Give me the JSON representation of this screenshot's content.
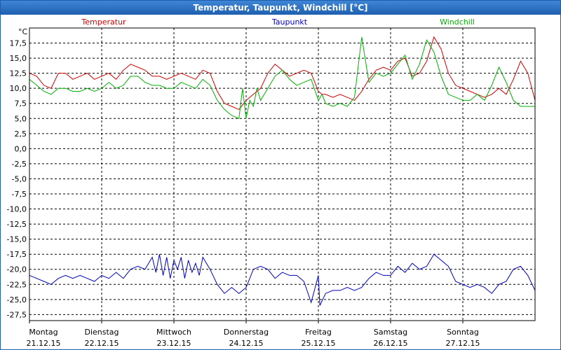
{
  "window": {
    "title": "Temperatur, Taupunkt, Windchill [°C]"
  },
  "chart_data": {
    "type": "line",
    "title": "Temperatur, Taupunkt, Windchill [°C]",
    "ylabel": "°C",
    "ylim": [
      -28.5,
      20.0
    ],
    "xlim": [
      0,
      7
    ],
    "grid": true,
    "legend": "top",
    "yticks": [
      "17,5",
      "15,0",
      "12,5",
      "10,0",
      "7,5",
      "5,0",
      "2,5",
      "0,0",
      "-2,5",
      "-5,0",
      "-7,5",
      "-10,0",
      "-12,5",
      "-15,0",
      "-17,5",
      "-20,0",
      "-22,5",
      "-25,0",
      "-27,5"
    ],
    "ytick_values": [
      17.5,
      15,
      12.5,
      10,
      7.5,
      5,
      2.5,
      0,
      -2.5,
      -5,
      -7.5,
      -10,
      -12.5,
      -15,
      -17.5,
      -20,
      -22.5,
      -25,
      -27.5
    ],
    "days": [
      {
        "name": "Montag",
        "date": "21.12.15"
      },
      {
        "name": "Dienstag",
        "date": "22.12.15"
      },
      {
        "name": "Mittwoch",
        "date": "23.12.15"
      },
      {
        "name": "Donnerstag",
        "date": "24.12.15"
      },
      {
        "name": "Freitag",
        "date": "25.12.15"
      },
      {
        "name": "Samstag",
        "date": "26.12.15"
      },
      {
        "name": "Sonntag",
        "date": "27.12.15"
      }
    ],
    "series": [
      {
        "name": "Temperatur",
        "color": "#d00000",
        "x": [
          0.0,
          0.1,
          0.2,
          0.3,
          0.4,
          0.5,
          0.6,
          0.7,
          0.8,
          0.9,
          1.0,
          1.1,
          1.2,
          1.3,
          1.4,
          1.5,
          1.6,
          1.7,
          1.8,
          1.9,
          2.0,
          2.1,
          2.2,
          2.3,
          2.4,
          2.5,
          2.6,
          2.7,
          2.8,
          2.9,
          3.0,
          3.1,
          3.2,
          3.3,
          3.4,
          3.5,
          3.6,
          3.7,
          3.8,
          3.9,
          4.0,
          4.05,
          4.1,
          4.2,
          4.3,
          4.4,
          4.5,
          4.6,
          4.7,
          4.8,
          4.9,
          5.0,
          5.1,
          5.2,
          5.3,
          5.4,
          5.5,
          5.6,
          5.7,
          5.8,
          5.9,
          6.0,
          6.1,
          6.2,
          6.3,
          6.4,
          6.5,
          6.6,
          6.7,
          6.8,
          6.9,
          7.0
        ],
        "y": [
          12.5,
          12.0,
          10.5,
          10.0,
          12.5,
          12.5,
          11.5,
          12.0,
          12.5,
          11.5,
          12.0,
          12.5,
          11.5,
          13.0,
          14.0,
          13.5,
          13.0,
          12.0,
          12.0,
          11.5,
          12.0,
          12.5,
          12.0,
          11.5,
          13.0,
          12.5,
          9.5,
          7.5,
          7.0,
          6.5,
          8.0,
          9.0,
          10.0,
          12.5,
          14.0,
          13.0,
          12.0,
          12.5,
          13.0,
          12.5,
          9.5,
          9.0,
          9.0,
          8.5,
          9.0,
          8.5,
          8.0,
          9.5,
          11.5,
          13.0,
          13.5,
          13.0,
          14.5,
          15.0,
          12.0,
          12.5,
          14.5,
          18.5,
          16.5,
          12.5,
          10.5,
          10.0,
          9.5,
          9.0,
          8.5,
          9.0,
          10.0,
          9.0,
          11.5,
          14.5,
          12.5,
          8.0
        ]
      },
      {
        "name": "Taupunkt",
        "color": "#0000c0",
        "x": [
          0.0,
          0.1,
          0.2,
          0.3,
          0.4,
          0.5,
          0.6,
          0.7,
          0.8,
          0.9,
          1.0,
          1.1,
          1.2,
          1.3,
          1.4,
          1.5,
          1.6,
          1.7,
          1.75,
          1.8,
          1.85,
          1.9,
          1.95,
          2.0,
          2.05,
          2.1,
          2.15,
          2.2,
          2.25,
          2.3,
          2.35,
          2.4,
          2.5,
          2.6,
          2.7,
          2.8,
          2.9,
          3.0,
          3.1,
          3.2,
          3.3,
          3.4,
          3.5,
          3.6,
          3.7,
          3.8,
          3.9,
          4.0,
          4.02,
          4.1,
          4.2,
          4.3,
          4.4,
          4.5,
          4.6,
          4.7,
          4.8,
          4.9,
          5.0,
          5.1,
          5.2,
          5.3,
          5.4,
          5.5,
          5.6,
          5.7,
          5.8,
          5.9,
          6.0,
          6.1,
          6.2,
          6.3,
          6.4,
          6.5,
          6.6,
          6.7,
          6.8,
          6.9,
          7.0
        ],
        "y": [
          -21.0,
          -21.5,
          -22.0,
          -22.5,
          -21.5,
          -21.0,
          -21.5,
          -21.0,
          -21.5,
          -22.0,
          -21.0,
          -21.5,
          -20.5,
          -21.5,
          -20.0,
          -19.5,
          -20.0,
          -18.0,
          -20.5,
          -17.5,
          -21.0,
          -18.0,
          -21.5,
          -18.5,
          -20.0,
          -18.0,
          -21.5,
          -18.5,
          -20.5,
          -19.0,
          -21.0,
          -18.0,
          -20.0,
          -22.5,
          -24.0,
          -23.0,
          -24.0,
          -23.0,
          -20.0,
          -19.5,
          -20.0,
          -21.5,
          -20.5,
          -21.0,
          -21.0,
          -22.0,
          -25.5,
          -21.0,
          -26.0,
          -24.0,
          -23.5,
          -23.5,
          -23.0,
          -23.5,
          -23.0,
          -21.5,
          -20.5,
          -21.0,
          -21.0,
          -19.5,
          -20.5,
          -19.0,
          -20.0,
          -19.5,
          -17.5,
          -18.5,
          -19.5,
          -22.0,
          -22.5,
          -23.0,
          -22.5,
          -23.0,
          -24.0,
          -22.5,
          -22.0,
          -20.0,
          -19.5,
          -21.0,
          -23.5
        ]
      },
      {
        "name": "Windchill",
        "color": "#00b000",
        "x": [
          0.0,
          0.1,
          0.2,
          0.3,
          0.4,
          0.5,
          0.6,
          0.7,
          0.8,
          0.9,
          1.0,
          1.1,
          1.2,
          1.3,
          1.4,
          1.5,
          1.6,
          1.7,
          1.8,
          1.9,
          2.0,
          2.1,
          2.2,
          2.3,
          2.4,
          2.5,
          2.6,
          2.7,
          2.8,
          2.9,
          2.95,
          3.0,
          3.05,
          3.1,
          3.15,
          3.2,
          3.3,
          3.4,
          3.5,
          3.6,
          3.7,
          3.8,
          3.9,
          4.0,
          4.05,
          4.1,
          4.2,
          4.3,
          4.4,
          4.5,
          4.6,
          4.7,
          4.8,
          4.9,
          5.0,
          5.1,
          5.2,
          5.3,
          5.4,
          5.5,
          5.6,
          5.7,
          5.8,
          5.9,
          6.0,
          6.1,
          6.2,
          6.3,
          6.4,
          6.5,
          6.6,
          6.7,
          6.8,
          6.9,
          7.0
        ],
        "y": [
          11.5,
          10.5,
          9.5,
          9.0,
          10.0,
          10.0,
          9.5,
          9.5,
          10.0,
          9.5,
          10.0,
          11.0,
          10.0,
          10.5,
          12.0,
          12.0,
          11.0,
          10.5,
          10.5,
          10.0,
          10.0,
          11.0,
          10.5,
          10.0,
          11.5,
          10.5,
          8.0,
          6.5,
          5.5,
          5.0,
          10.0,
          5.0,
          8.0,
          7.0,
          10.0,
          8.0,
          10.0,
          12.0,
          13.0,
          11.5,
          10.5,
          11.0,
          11.5,
          8.0,
          9.0,
          7.5,
          7.0,
          7.5,
          7.0,
          8.5,
          18.5,
          11.0,
          12.5,
          12.0,
          12.5,
          14.0,
          15.5,
          11.5,
          14.0,
          18.0,
          16.0,
          12.0,
          9.0,
          8.5,
          8.0,
          8.0,
          9.0,
          8.0,
          10.5,
          13.5,
          11.0,
          8.0,
          7.0,
          7.0,
          7.0
        ]
      }
    ]
  }
}
